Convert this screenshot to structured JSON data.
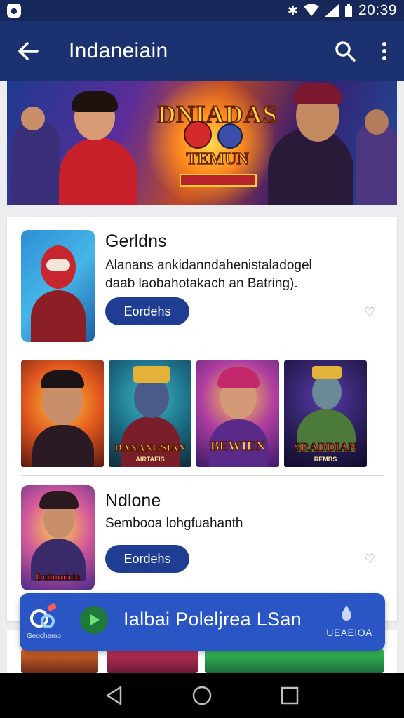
{
  "status_bar": {
    "time": "20:39"
  },
  "app_bar": {
    "title": "Indaneiain"
  },
  "hero": {
    "title": "DNIADAS",
    "subtitle": "TEMUN"
  },
  "apps": [
    {
      "name": "Gerldns",
      "description": "Alanans ankidanndahenistaladogel daab laobahotakach an Batring).",
      "button_label": "Eordehs"
    },
    {
      "name": "Ndlone",
      "description": "Sembooa lohgfuahanth",
      "button_label": "Eordehs",
      "icon_caption": "Deiiomiria"
    }
  ],
  "thumbnails": [
    {
      "caption": "",
      "subcaption": ""
    },
    {
      "caption": "DANANGSIAN",
      "subcaption": "AIRTAEIS"
    },
    {
      "caption": "BEWIEN",
      "subcaption": ""
    },
    {
      "caption": "SRADDIAN",
      "subcaption": "REMBS"
    }
  ],
  "promo": {
    "title": "Ialbai Poleljrea LSan",
    "logo_text": "Geochemo",
    "badge": "UEAEIOA"
  },
  "colors": {
    "status_bar": "#16285a",
    "app_bar": "#1c3170",
    "button": "#1f3e93",
    "promo": "#2a56c5"
  }
}
